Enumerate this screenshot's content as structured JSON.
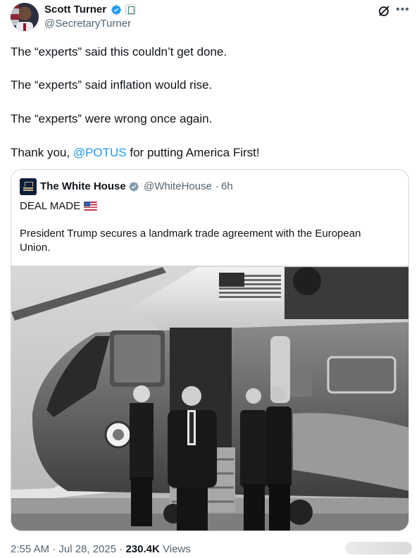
{
  "author": {
    "name": "Scott Turner",
    "handle": "@SecretaryTurner"
  },
  "tweet": {
    "line1": "The “experts” said this couldn’t get done.",
    "line2": "The “experts” said inflation would rise.",
    "line3": "The “experts” were wrong once again.",
    "line4_prefix": "Thank you, ",
    "line4_mention": "@POTUS",
    "line4_suffix": " for putting America First!"
  },
  "quoted": {
    "name": "The White House",
    "handle": "@WhiteHouse",
    "separator": "·",
    "time": "6h",
    "headline": "DEAL MADE",
    "body": "President Trump secures a landmark trade agreement with the European Union."
  },
  "footer": {
    "time": "2:55 AM",
    "date": "Jul 28, 2025",
    "views_count": "230.4K",
    "views_label": "Views"
  },
  "colors": {
    "text": "#0f1419",
    "secondary": "#536471",
    "link": "#1d9bf0",
    "border": "#cfd9de",
    "verified_badge": "#1d9bf0"
  },
  "icons": {
    "verified": "verified-badge-icon",
    "affiliation": "government-affiliation-icon",
    "grok": "grok-icon",
    "more": "more-options-icon",
    "flag": "us-flag-icon"
  }
}
